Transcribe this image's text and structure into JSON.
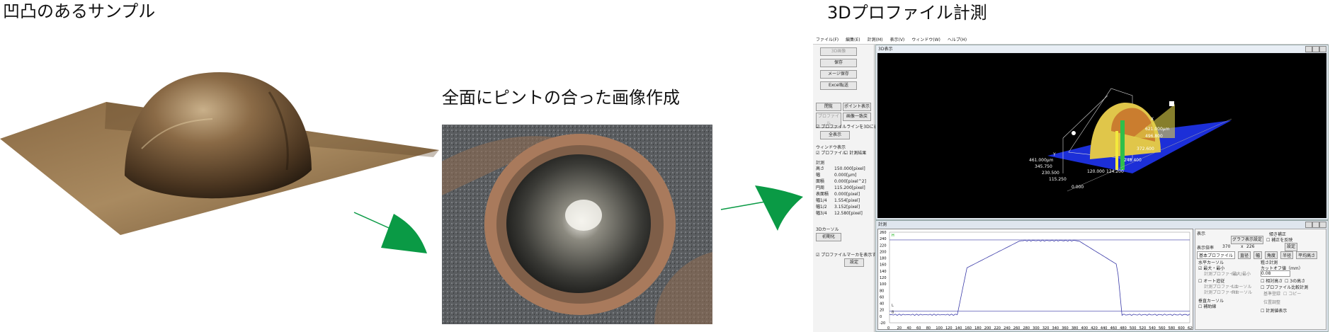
{
  "labels": {
    "sample": "凹凸のあるサンプル",
    "focus": "全面にピントの合った画像作成",
    "profile3d": "3Dプロファイル計測"
  },
  "colors": {
    "arrow": "#0a9a45",
    "profile_line": "#3a3aa8",
    "dome_top": "#5a4a34",
    "ring": "#b07a5a"
  },
  "app": {
    "menu": [
      "ファイル(F)",
      "編集(E)",
      "計測(M)",
      "表示(V)",
      "ウィンドウ(W)",
      "ヘルプ(H)"
    ],
    "side_buttons": [
      "3D画像",
      "保存",
      "メージ保存",
      "Excel転送",
      "閉覧",
      "ポイント表示",
      "プロファイル",
      "画像一致戻",
      "全表示",
      "初期化",
      "設定"
    ],
    "side_checkboxes": [
      "プロファイルラインを3Dに表示する",
      "プロファイル",
      "計測結果",
      "プロファイルマーカを表示する"
    ],
    "side_headers": [
      "ウィンドウ表示",
      "計測",
      "3Dカーソル"
    ],
    "measurements": [
      {
        "name": "高さ",
        "value": "150.000[pixel]"
      },
      {
        "name": "幅",
        "value": "0.000[μm]"
      },
      {
        "name": "面積",
        "value": "0.000[pixel^2]"
      },
      {
        "name": "円周",
        "value": "115.200[pixel]"
      },
      {
        "name": "表面積",
        "value": "0.000[pixel]"
      },
      {
        "name": "幅1/4",
        "value": "1.554[pixel]"
      },
      {
        "name": "幅1/2",
        "value": "3.152[pixel]"
      },
      {
        "name": "幅3/4",
        "value": "12.580[pixel]"
      }
    ],
    "viewer_title": "3D表示",
    "profile_title": "計測",
    "axis3d": {
      "z_labels": [
        "461.000μm",
        "345.750",
        "230.500",
        "115.250",
        "0.000"
      ],
      "x_labels": [
        "0.000",
        "124.200",
        "248.400",
        "372.600",
        "496.800",
        "621.000μm"
      ],
      "y_label": "120.000",
      "x_axis_letter": "X",
      "y_axis_letter": "Y"
    },
    "profile_graph": {
      "y_ticks": [
        260,
        240,
        220,
        200,
        180,
        160,
        140,
        120,
        100,
        80,
        60,
        40,
        20,
        0,
        -20
      ],
      "x_ticks": [
        0,
        20,
        40,
        60,
        80,
        100,
        120,
        140,
        160,
        180,
        200,
        220,
        240,
        260,
        280,
        300,
        320,
        340,
        360,
        380,
        400,
        420,
        440,
        460,
        480,
        500,
        520,
        540,
        560,
        580,
        600,
        620
      ],
      "markers": [
        "H",
        "L",
        "B"
      ]
    },
    "controls": {
      "display": "表示",
      "graph_button": "グラフ表示設定",
      "scale_label": "表示倍率",
      "scale_w": "370",
      "scale_x": "x",
      "scale_h": "226",
      "correction": "傾き補正",
      "correction_check": "補正を反映",
      "setting": "設定",
      "tabs": [
        "基本プロファイル",
        "直径",
        "幅",
        "角度",
        "半径",
        "平均高さ"
      ],
      "cursor_label": "水平カーソル",
      "minmax": "最大・最小",
      "profile_sel": "計測プロファイル",
      "maxmin_sel": "最大/最小",
      "auto_follow": "オート追従",
      "profile_a": "計測プロファイル",
      "profile_b": "計測プロファイル",
      "cursor_l": "Lカーソル",
      "cursor_r": "Rカーソル",
      "vcursor": "垂直カーソル",
      "grid_line": "補助線",
      "calc_header": "粗さ計測",
      "cutoff": "カットオフ値（mm）",
      "cutoff_val": "0.08",
      "rel_height": "相対高さ",
      "rel_check": "3の高さ",
      "multi": "プロファイル比較計測",
      "base": "基準登録",
      "copy": "コピー",
      "pos_adj": "位置調整",
      "calc_show": "計測値表示"
    }
  }
}
